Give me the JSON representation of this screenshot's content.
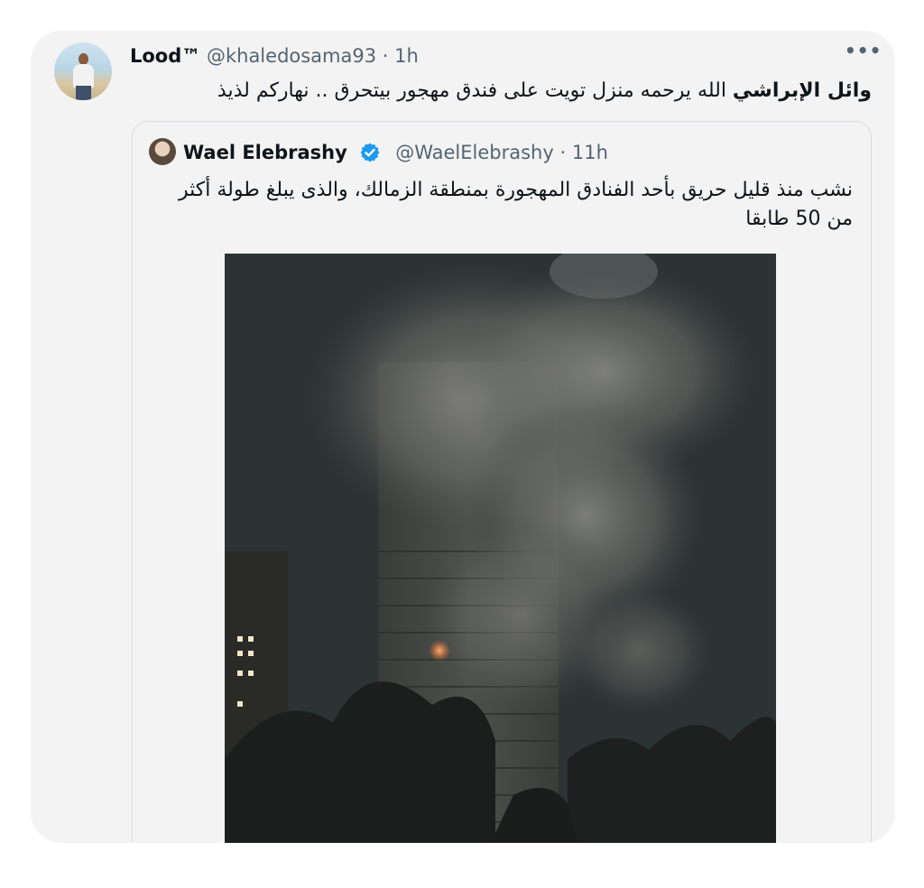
{
  "tweet": {
    "display_name": "Lood™",
    "handle": "@khaledosama93",
    "separator": "·",
    "time": "1h",
    "text_bold": "وائل الإبراشي",
    "text_rest": " الله يرحمه منزل تويت على فندق مهجور بيتحرق .. نهاركم لذيذ",
    "more_icon": "more-horizontal-icon"
  },
  "quoted_tweet": {
    "display_name": "Wael Elebrashy",
    "handle": "@WaelElebrashy",
    "separator": "·",
    "time": "11h",
    "verified_icon": "verified-badge-icon",
    "verified_color": "#1d9bf0",
    "text": "نشب منذ قليل حريق بأحد الفنادق المهجورة بمنطقة الزمالك، والذى يبلغ طولة أكثر من 50 طابقا"
  }
}
